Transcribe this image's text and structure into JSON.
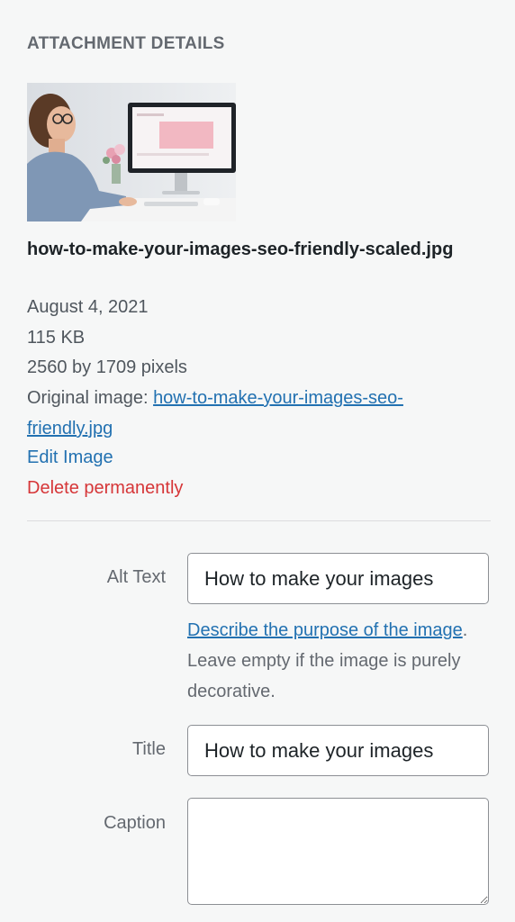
{
  "section": {
    "heading": "ATTACHMENT DETAILS"
  },
  "attachment": {
    "filename": "how-to-make-your-images-seo-friendly-scaled.jpg",
    "date": "August 4, 2021",
    "filesize": "115 KB",
    "dimensions": "2560 by 1709 pixels",
    "original_label": "Original image: ",
    "original_link": "how-to-make-your-images-seo-friendly.jpg",
    "edit_link": "Edit Image",
    "delete_link": "Delete permanently"
  },
  "fields": {
    "alt_label": "Alt Text",
    "alt_value": "How to make your images",
    "alt_help_link": "Describe the purpose of the image",
    "alt_help_text": ". Leave empty if the image is purely decorative.",
    "title_label": "Title",
    "title_value": "How to make your images",
    "caption_label": "Caption",
    "caption_value": ""
  },
  "colors": {
    "link": "#2271b1",
    "danger": "#d63638",
    "background": "#f6f7f7"
  }
}
